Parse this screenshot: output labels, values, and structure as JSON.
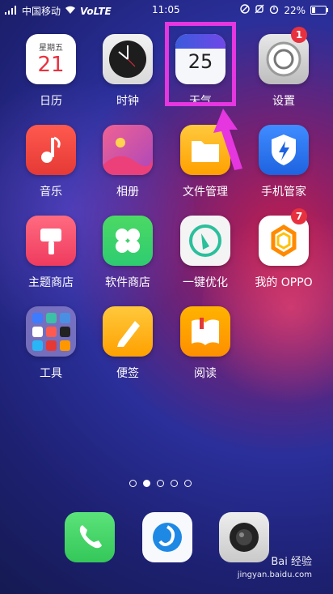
{
  "status_bar": {
    "carrier": "中国移动",
    "network": "VoLTE",
    "time": "11:05",
    "battery": "22%",
    "battery_level": 0.22
  },
  "apps": [
    {
      "label": "日历",
      "icon": "calendar-icon",
      "cal_weekday": "星期五",
      "cal_day": "21"
    },
    {
      "label": "时钟",
      "icon": "clock-icon"
    },
    {
      "label": "天气",
      "icon": "weather-icon",
      "weather_temp": "25"
    },
    {
      "label": "设置",
      "icon": "settings-icon",
      "badge": "1"
    },
    {
      "label": "音乐",
      "icon": "music-icon"
    },
    {
      "label": "相册",
      "icon": "gallery-icon"
    },
    {
      "label": "文件管理",
      "icon": "folder-icon"
    },
    {
      "label": "手机管家",
      "icon": "shield-icon"
    },
    {
      "label": "主题商店",
      "icon": "brush-icon"
    },
    {
      "label": "软件商店",
      "icon": "appstore-icon"
    },
    {
      "label": "一键优化",
      "icon": "broom-icon"
    },
    {
      "label": "我的 OPPO",
      "icon": "oppo-icon",
      "badge": "7"
    },
    {
      "label": "工具",
      "icon": "folder-tools-icon"
    },
    {
      "label": "便签",
      "icon": "pencil-icon"
    },
    {
      "label": "阅读",
      "icon": "book-icon"
    }
  ],
  "page_dots": {
    "count": 5,
    "active": 1
  },
  "dock": [
    {
      "icon": "phone-icon"
    },
    {
      "icon": "browser-icon"
    },
    {
      "icon": "camera-icon"
    }
  ],
  "watermark": {
    "brand": "Bai 经验",
    "url": "jingyan.baidu.com"
  },
  "colors": {
    "highlight": "#e536e0",
    "badge": "#e8313f"
  }
}
